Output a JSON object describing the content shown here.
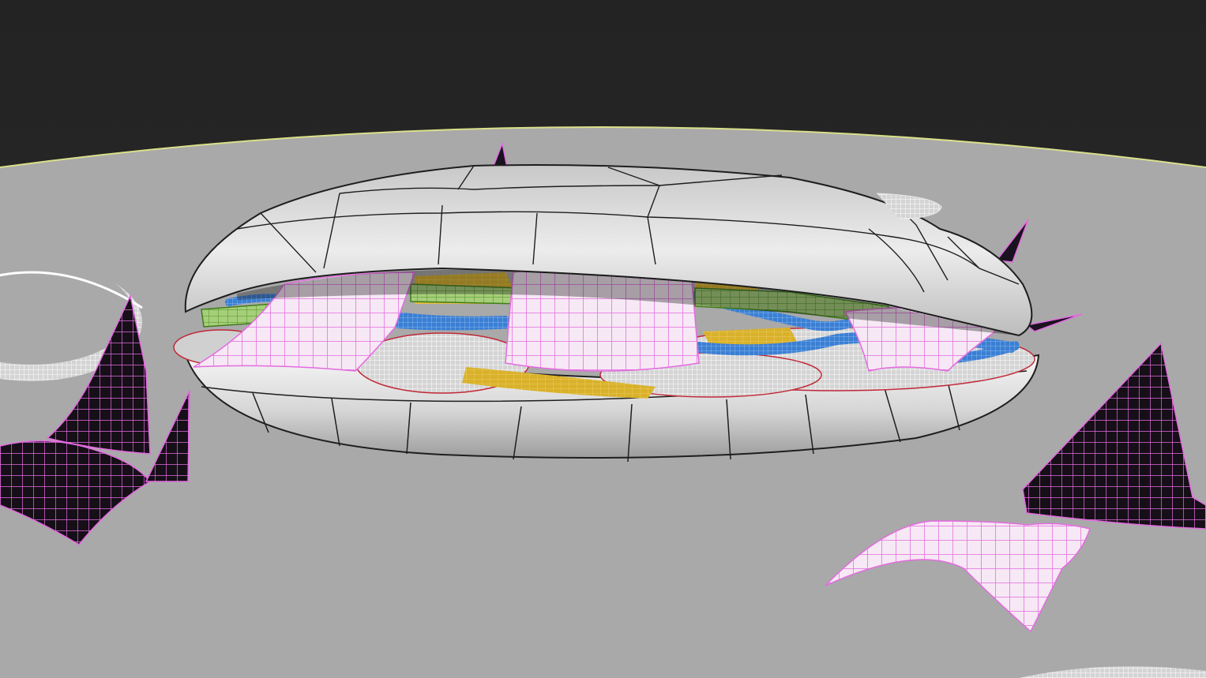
{
  "viewport": {
    "colors": {
      "background": "#262626",
      "ground": "#a9a9a9",
      "ground_outline": "#d9e08a",
      "wireframe_white": "#f2f2f2",
      "wireframe_magenta": "#e46be0",
      "bun_fill": "#dcdcdc",
      "bun_edges": "#1e1e1e",
      "lettuce_green": "#7db24a",
      "cheese_yellow": "#d9b12a",
      "noodle_blue": "#3a7fd4",
      "dark_patch": "#140f16"
    },
    "objects": [
      {
        "name": "ground-plane"
      },
      {
        "name": "sandwich-bun-top"
      },
      {
        "name": "sandwich-bun-bottom"
      },
      {
        "name": "tomato-slice-ring"
      },
      {
        "name": "cheese-strips"
      },
      {
        "name": "noodle-tubes"
      },
      {
        "name": "lettuce-boxes"
      },
      {
        "name": "ham-slices"
      },
      {
        "name": "loose-leaf-left"
      },
      {
        "name": "loose-leaf-right"
      }
    ]
  }
}
